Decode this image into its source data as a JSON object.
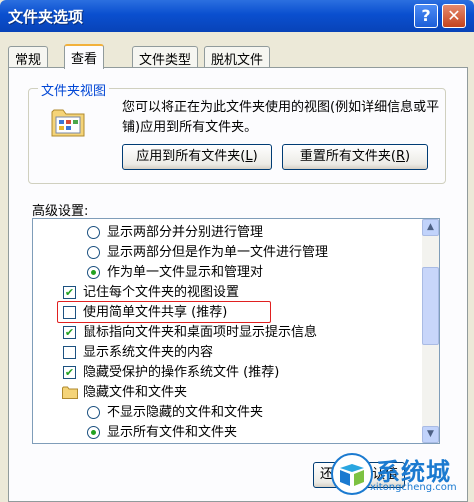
{
  "window": {
    "title": "文件夹选项",
    "help_glyph": "?",
    "close_glyph": "✕"
  },
  "tabs": [
    {
      "label": "常规",
      "active": false
    },
    {
      "label": "查看",
      "active": true
    },
    {
      "label": "文件类型",
      "active": false
    },
    {
      "label": "脱机文件",
      "active": false
    }
  ],
  "folder_views": {
    "title": "文件夹视图",
    "description": "您可以将正在为此文件夹使用的视图(例如详细信息或平铺)应用到所有文件夹。",
    "apply_all_label": "应用到所有文件夹",
    "apply_all_key": "L",
    "reset_all_label": "重置所有文件夹",
    "reset_all_key": "R"
  },
  "advanced": {
    "label": "高级设置:",
    "items": [
      {
        "type": "radio",
        "checked": false,
        "text": "显示两部分并分别进行管理"
      },
      {
        "type": "radio",
        "checked": false,
        "text": "显示两部分但是作为单一文件进行管理"
      },
      {
        "type": "radio",
        "checked": true,
        "text": "作为单一文件显示和管理对"
      },
      {
        "type": "checkbox",
        "checked": true,
        "text": "记住每个文件夹的视图设置"
      },
      {
        "type": "checkbox",
        "checked": false,
        "text": "使用简单文件共享 (推荐)"
      },
      {
        "type": "checkbox",
        "checked": true,
        "text": "鼠标指向文件夹和桌面项时显示提示信息"
      },
      {
        "type": "checkbox",
        "checked": false,
        "text": "显示系统文件夹的内容"
      },
      {
        "type": "checkbox",
        "checked": true,
        "text": "隐藏受保护的操作系统文件 (推荐)"
      },
      {
        "type": "folder",
        "text": "隐藏文件和文件夹"
      },
      {
        "type": "radio",
        "checked": false,
        "text": "不显示隐藏的文件和文件夹"
      },
      {
        "type": "radio",
        "checked": true,
        "text": "显示所有文件和文件夹"
      }
    ]
  },
  "bottom_button": {
    "label": "还原为默认值"
  },
  "watermark": {
    "brand": "系统城",
    "url": "xitongcheng.com"
  },
  "colors": {
    "accent": "#0046d5",
    "highlight": "#e02020",
    "check": "#21a121"
  }
}
